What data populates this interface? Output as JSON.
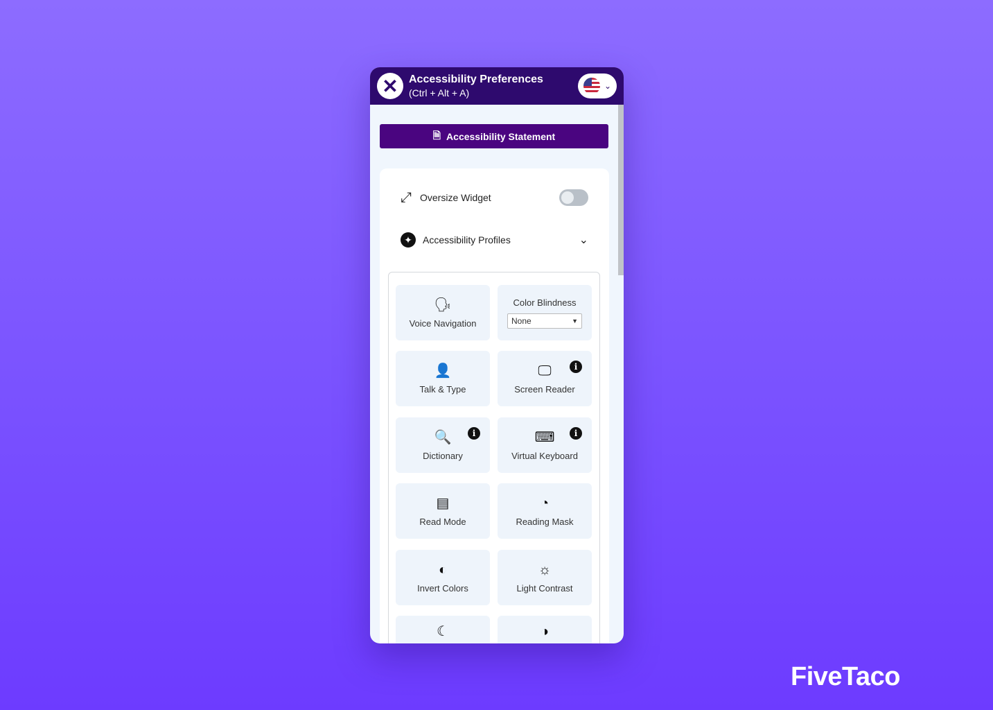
{
  "header": {
    "title": "Accessibility Preferences",
    "shortcut": "(Ctrl + Alt + A)",
    "language": "English (US)"
  },
  "statement_button": "Accessibility Statement",
  "oversize_widget": {
    "label": "Oversize Widget",
    "enabled": false
  },
  "profiles": {
    "label": "Accessibility Profiles"
  },
  "tiles": [
    {
      "label": "Voice Navigation",
      "icon": "voice-head-icon"
    },
    {
      "label": "Color Blindness",
      "select_value": "None"
    },
    {
      "label": "Talk & Type",
      "icon": "speaking-head-icon"
    },
    {
      "label": "Screen Reader",
      "icon": "screen-speaker-icon",
      "info": true
    },
    {
      "label": "Dictionary",
      "icon": "magnifier-a-icon",
      "info": true
    },
    {
      "label": "Virtual Keyboard",
      "icon": "keyboard-icon",
      "info": true
    },
    {
      "label": "Read Mode",
      "icon": "document-icon"
    },
    {
      "label": "Reading Mask",
      "icon": "mask-icon"
    },
    {
      "label": "Invert Colors",
      "icon": "invert-drop-icon"
    },
    {
      "label": "Light Contrast",
      "icon": "sun-icon"
    },
    {
      "label": "",
      "icon": "moon-icon"
    },
    {
      "label": "",
      "icon": "half-circle-icon"
    }
  ],
  "brand": "FiveTaco",
  "colors": {
    "header": "#2e0a6e",
    "button": "#4a0580",
    "background": "#7a52ff"
  }
}
